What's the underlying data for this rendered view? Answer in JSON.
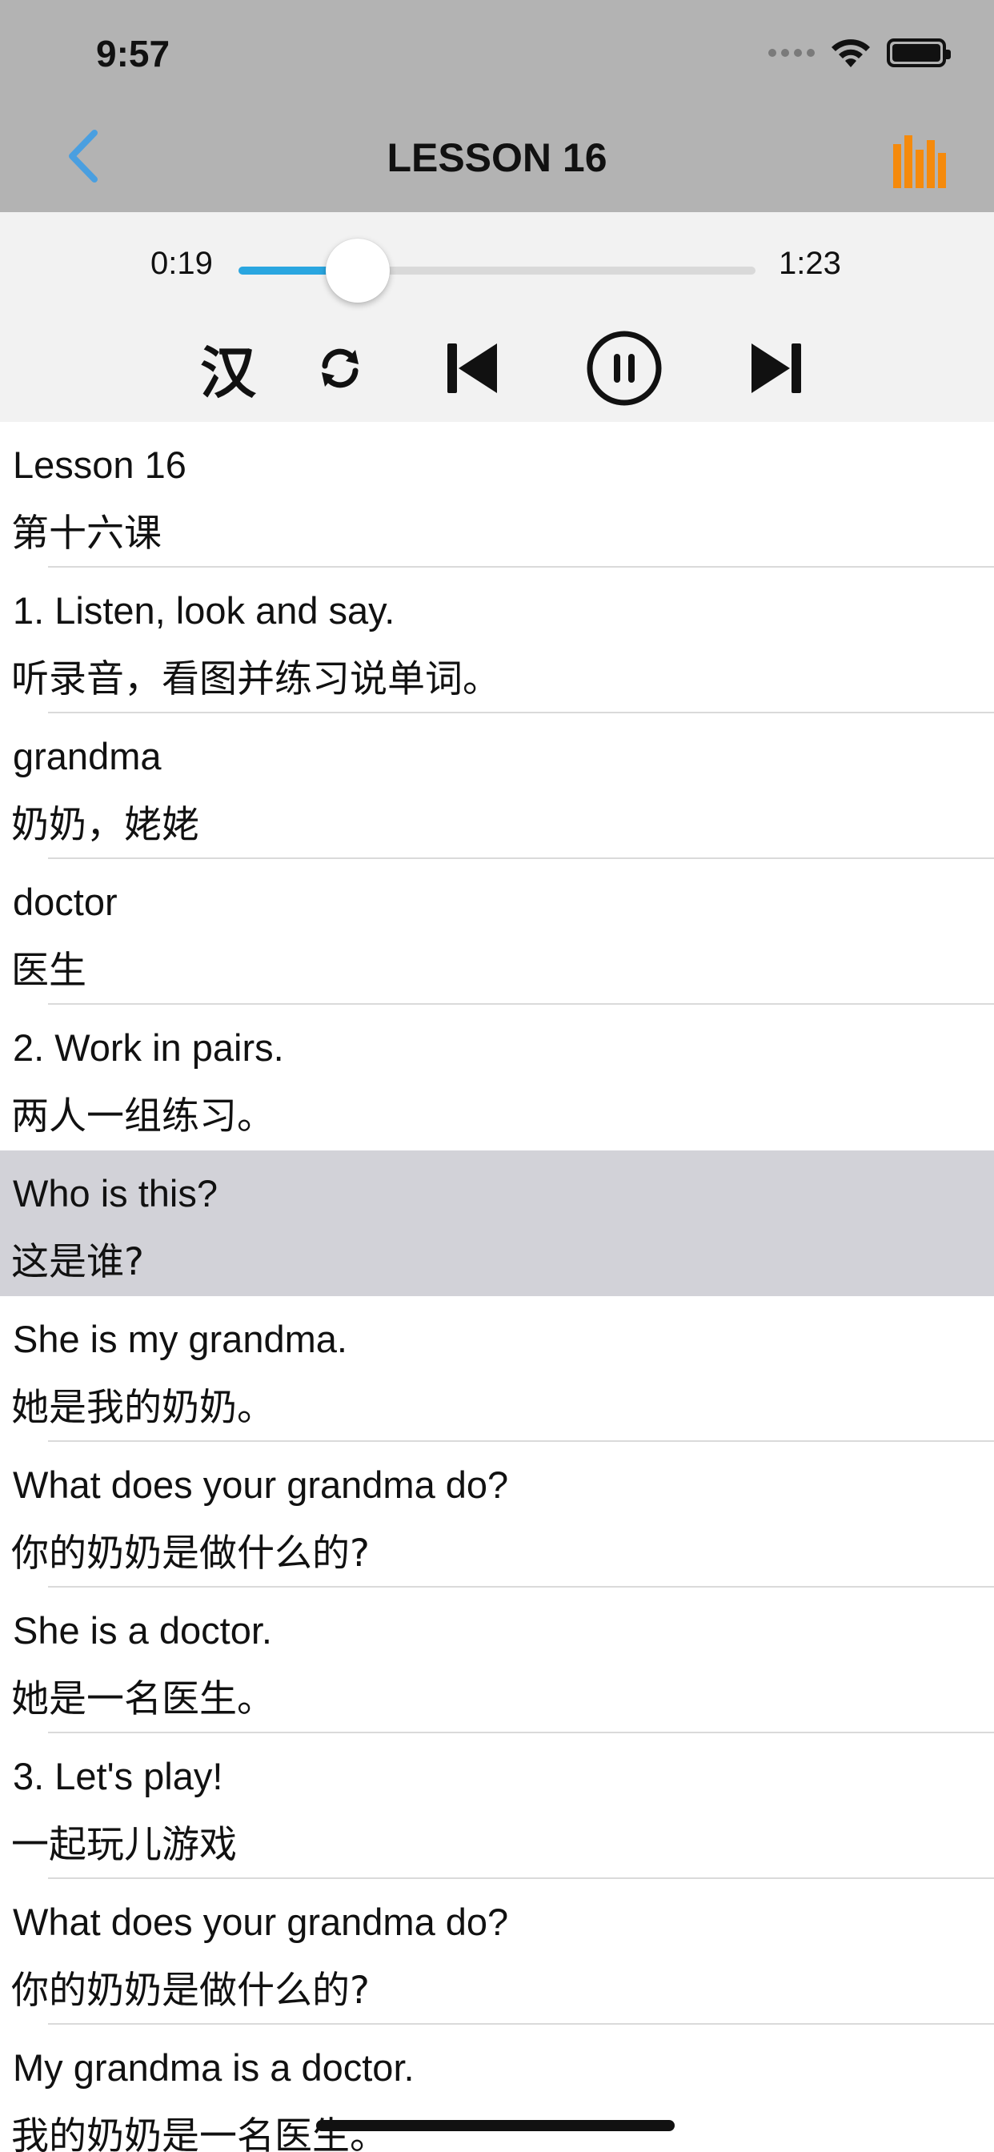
{
  "status_bar": {
    "time": "9:57"
  },
  "nav": {
    "title": "LESSON 16"
  },
  "player": {
    "current_time": "0:19",
    "total_time": "1:23",
    "progress_fraction": 0.23,
    "chinese_toggle_label": "汉"
  },
  "colors": {
    "accent_blue": "#2aa6e0",
    "back_arrow_blue": "#4a9fe0",
    "equalizer_orange": "#f58a0c",
    "selected_row_bg": "#d2d2d8"
  },
  "lines": [
    {
      "en": "Lesson 16",
      "zh": "第十六课"
    },
    {
      "en": "1. Listen, look and say.",
      "zh": "听录音，看图并练习说单词。"
    },
    {
      "en": "grandma",
      "zh": "奶奶，姥姥"
    },
    {
      "en": "doctor",
      "zh": "医生"
    },
    {
      "en": "2. Work in pairs.",
      "zh": "两人一组练习。"
    },
    {
      "en": "Who is this?",
      "zh": "这是谁?"
    },
    {
      "en": "She is my grandma.",
      "zh": "她是我的奶奶。"
    },
    {
      "en": "What does your grandma do?",
      "zh": "你的奶奶是做什么的?"
    },
    {
      "en": "She is a doctor.",
      "zh": "她是一名医生。"
    },
    {
      "en": "3. Let's play!",
      "zh": "一起玩儿游戏"
    },
    {
      "en": "What does your grandma do?",
      "zh": "你的奶奶是做什么的?"
    },
    {
      "en": "My grandma is a doctor.",
      "zh": "我的奶奶是一名医生。"
    }
  ],
  "selected_line_index": 5
}
